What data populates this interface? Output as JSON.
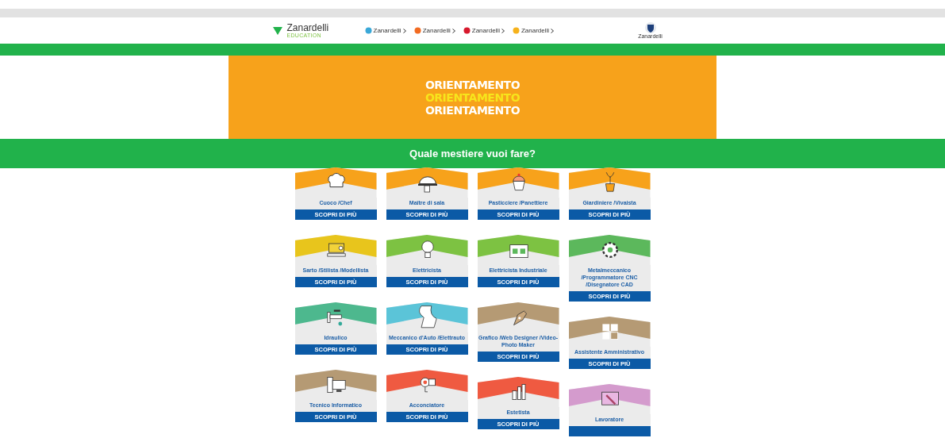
{
  "header": {
    "logo": {
      "name": "Zanardelli",
      "tagline": "EDUCATION"
    },
    "brands": [
      {
        "name": "Zanardelli",
        "color": "#3aa8d8"
      },
      {
        "name": "Zanardelli",
        "color": "#f26b21"
      },
      {
        "name": "Zanardelli",
        "color": "#d7192d"
      },
      {
        "name": "Zanardelli",
        "color": "#f6b21b"
      }
    ],
    "partner": "Zanardelli"
  },
  "banner": {
    "lines": [
      {
        "text": "ORIENTAMENTO",
        "color": "#ffffff"
      },
      {
        "text": "ORIENTAMENTO",
        "color": "#f7e51c"
      },
      {
        "text": "ORIENTAMENTO",
        "color": "#ffffff"
      }
    ]
  },
  "heading": "Quale mestiere vuoi fare?",
  "columns": [
    [
      {
        "title": "Cuoco /Chef",
        "color": "#f7a21b",
        "button": "SCOPRI DI PIÙ"
      },
      {
        "title": "Sarto /Stilista /Modellista",
        "color": "#e8c51c",
        "button": "SCOPRI DI PIÙ"
      },
      {
        "title": "Idraulico",
        "color": "#4db88e",
        "button": "SCOPRI DI PIÙ"
      },
      {
        "title": "Tecnico Informatico",
        "color": "#b59a74",
        "button": "SCOPRI DI PIÙ"
      }
    ],
    [
      {
        "title": "Maître di sala",
        "color": "#f7a21b",
        "button": "SCOPRI DI PIÙ"
      },
      {
        "title": "Elettricista",
        "color": "#7dc242",
        "button": "SCOPRI DI PIÙ"
      },
      {
        "title": "Meccanico d'Auto /Elettrauto",
        "color": "#5bc4d8",
        "button": "SCOPRI DI PIÙ"
      },
      {
        "title": "Acconciatore",
        "color": "#ef5a41",
        "button": "SCOPRI DI PIÙ"
      }
    ],
    [
      {
        "title": "Pasticciere /Panettiere",
        "color": "#f7a21b",
        "button": "SCOPRI DI PIÙ"
      },
      {
        "title": "Elettricista Industriale",
        "color": "#7dc242",
        "button": "SCOPRI DI PIÙ"
      },
      {
        "title": "Grafico /Web Designer /Video-Photo Maker",
        "color": "#b59a74",
        "button": "SCOPRI DI PIÙ"
      },
      {
        "title": "Estetista",
        "color": "#ef5a41",
        "button": "SCOPRI DI PIÙ"
      }
    ],
    [
      {
        "title": "Giardiniere /Vivaista",
        "color": "#f7a21b",
        "button": "SCOPRI DI PIÙ"
      },
      {
        "title": "Metalmeccanico /Programmatore CNC /Disegnatore CAD",
        "color": "#5cb85c",
        "button": "SCOPRI DI PIÙ"
      },
      {
        "title": "Assistente Amministrativo",
        "color": "#b59a74",
        "button": "SCOPRI DI PIÙ"
      },
      {
        "title": "Lavoratore",
        "color": "#d49bcd"
      }
    ]
  ]
}
